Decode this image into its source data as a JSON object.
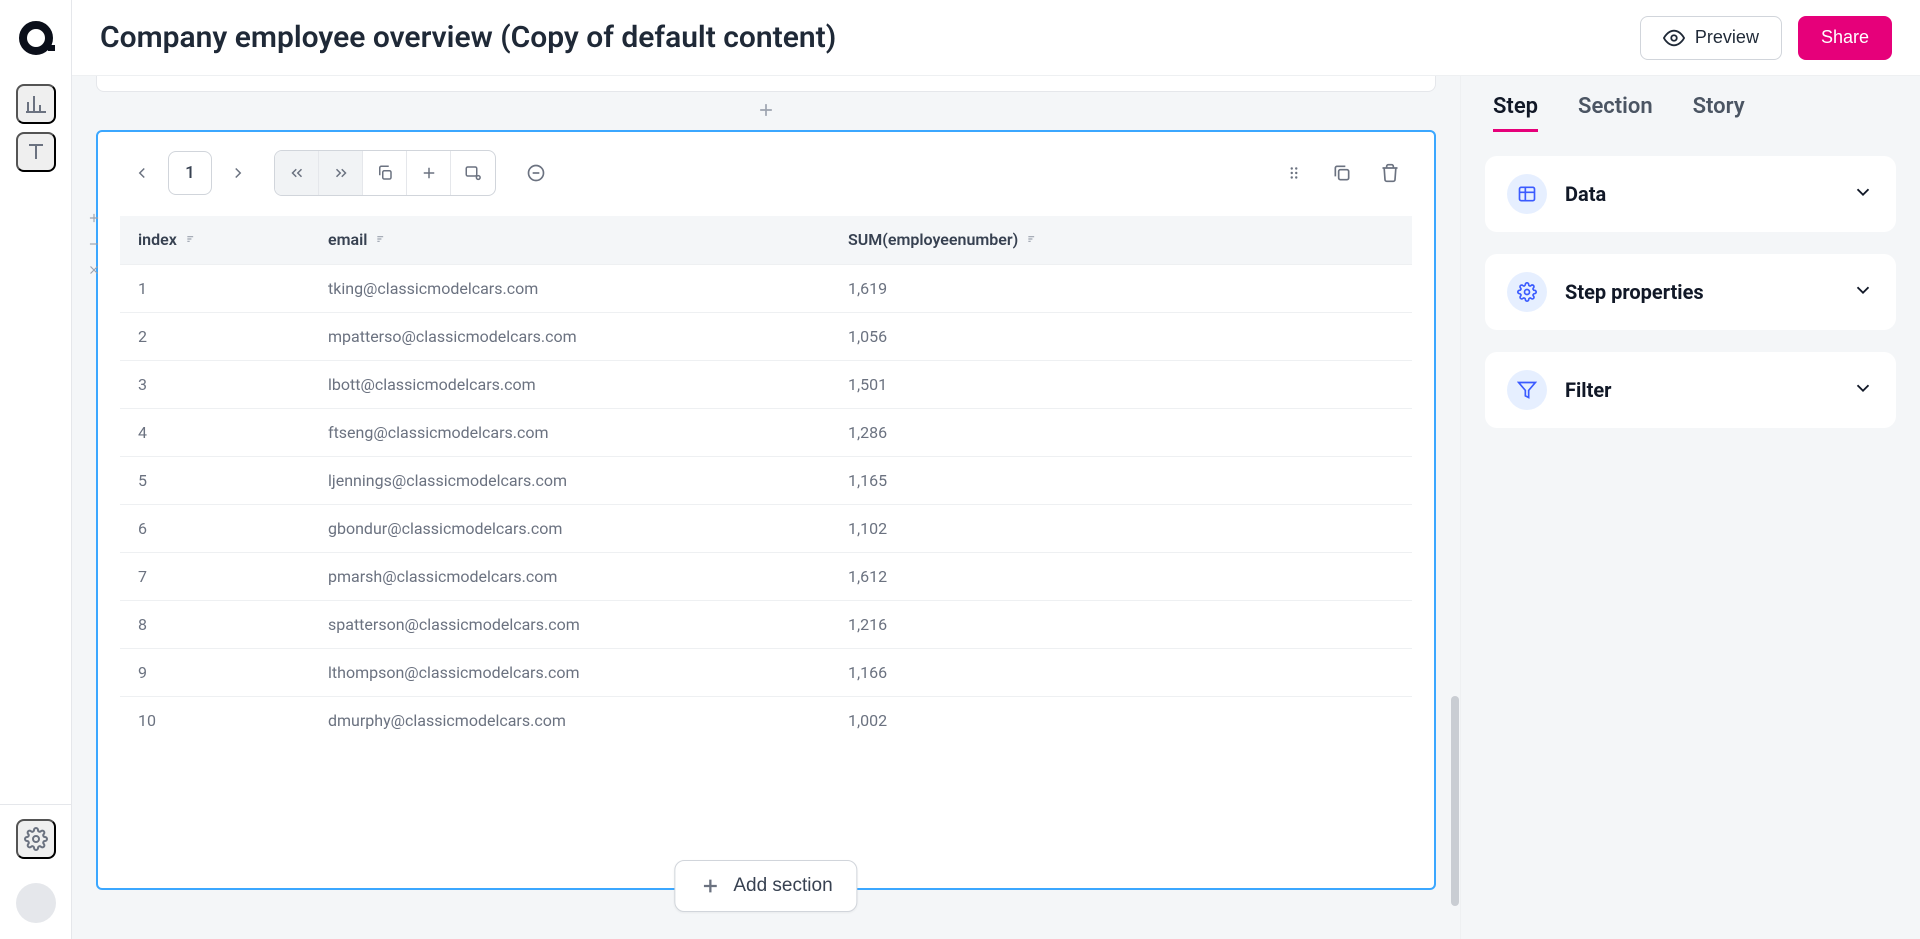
{
  "header": {
    "title": "Company employee overview (Copy of default content)",
    "preview_label": "Preview",
    "share_label": "Share"
  },
  "section": {
    "page_number": "1",
    "add_section_label": "Add section",
    "table": {
      "columns": [
        "index",
        "email",
        "SUM(employeenumber)"
      ],
      "rows": [
        {
          "index": "1",
          "email": "tking@classicmodelcars.com",
          "sum": "1,619"
        },
        {
          "index": "2",
          "email": "mpatterso@classicmodelcars.com",
          "sum": "1,056"
        },
        {
          "index": "3",
          "email": "lbott@classicmodelcars.com",
          "sum": "1,501"
        },
        {
          "index": "4",
          "email": "ftseng@classicmodelcars.com",
          "sum": "1,286"
        },
        {
          "index": "5",
          "email": "ljennings@classicmodelcars.com",
          "sum": "1,165"
        },
        {
          "index": "6",
          "email": "gbondur@classicmodelcars.com",
          "sum": "1,102"
        },
        {
          "index": "7",
          "email": "pmarsh@classicmodelcars.com",
          "sum": "1,612"
        },
        {
          "index": "8",
          "email": "spatterson@classicmodelcars.com",
          "sum": "1,216"
        },
        {
          "index": "9",
          "email": "lthompson@classicmodelcars.com",
          "sum": "1,166"
        },
        {
          "index": "10",
          "email": "dmurphy@classicmodelcars.com",
          "sum": "1,002"
        }
      ]
    }
  },
  "panel": {
    "tabs": [
      "Step",
      "Section",
      "Story"
    ],
    "active_tab": 0,
    "accordions": [
      {
        "id": "data",
        "label": "Data",
        "icon": "table-icon"
      },
      {
        "id": "props",
        "label": "Step properties",
        "icon": "gear-icon"
      },
      {
        "id": "filter",
        "label": "Filter",
        "icon": "filter-icon"
      }
    ]
  },
  "colors": {
    "accent": "#e6007a",
    "selection": "#3ba7ff"
  }
}
